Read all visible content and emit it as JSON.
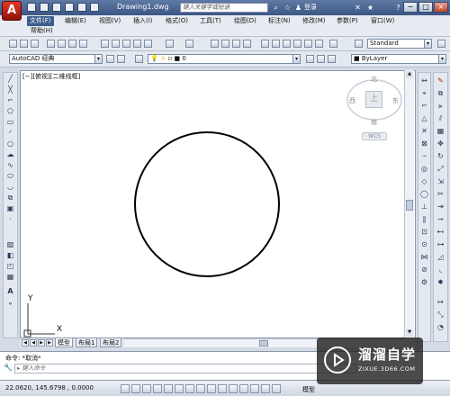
{
  "titlebar": {
    "app_logo": "A",
    "doc_title": "Drawing1.dwg",
    "search_placeholder": "键入关键字或短语",
    "signin": "登录",
    "help": "?",
    "minimize": "−",
    "maximize": "□",
    "close": "×"
  },
  "menu": {
    "items": [
      "文件(F)",
      "编辑(E)",
      "视图(V)",
      "插入(I)",
      "格式(O)",
      "工具(T)",
      "绘图(D)",
      "标注(N)",
      "修改(M)",
      "参数(P)",
      "窗口(W)"
    ],
    "row2": [
      "帮助(H)"
    ]
  },
  "toolbar": {
    "text_style": "Standard",
    "workspace": "AutoCAD 经典",
    "layer": "0",
    "linetype": "ByLayer"
  },
  "canvas": {
    "viewport_label": "[−][俯视][二维线框]",
    "viewcube": {
      "north": "北",
      "south": "南",
      "east": "东",
      "west": "西",
      "top": "上",
      "wcs": "WCS"
    },
    "ucs_x": "X",
    "ucs_y": "Y"
  },
  "tabs": [
    "模型",
    "布局1",
    "布局2"
  ],
  "command": {
    "history": "命令: *取消*",
    "prompt": "键入命令"
  },
  "status": {
    "coords": "22.0620,  145.6798 ,  0.0000",
    "model_label": "模型"
  },
  "watermark": {
    "brand": "溜溜自学",
    "url": "ZIXUE.3D66.COM"
  },
  "colors": {
    "titlebar": "#4a6592",
    "menu_active": "#3d5d8e",
    "canvas": "#ffffff",
    "circle": "#000000"
  }
}
